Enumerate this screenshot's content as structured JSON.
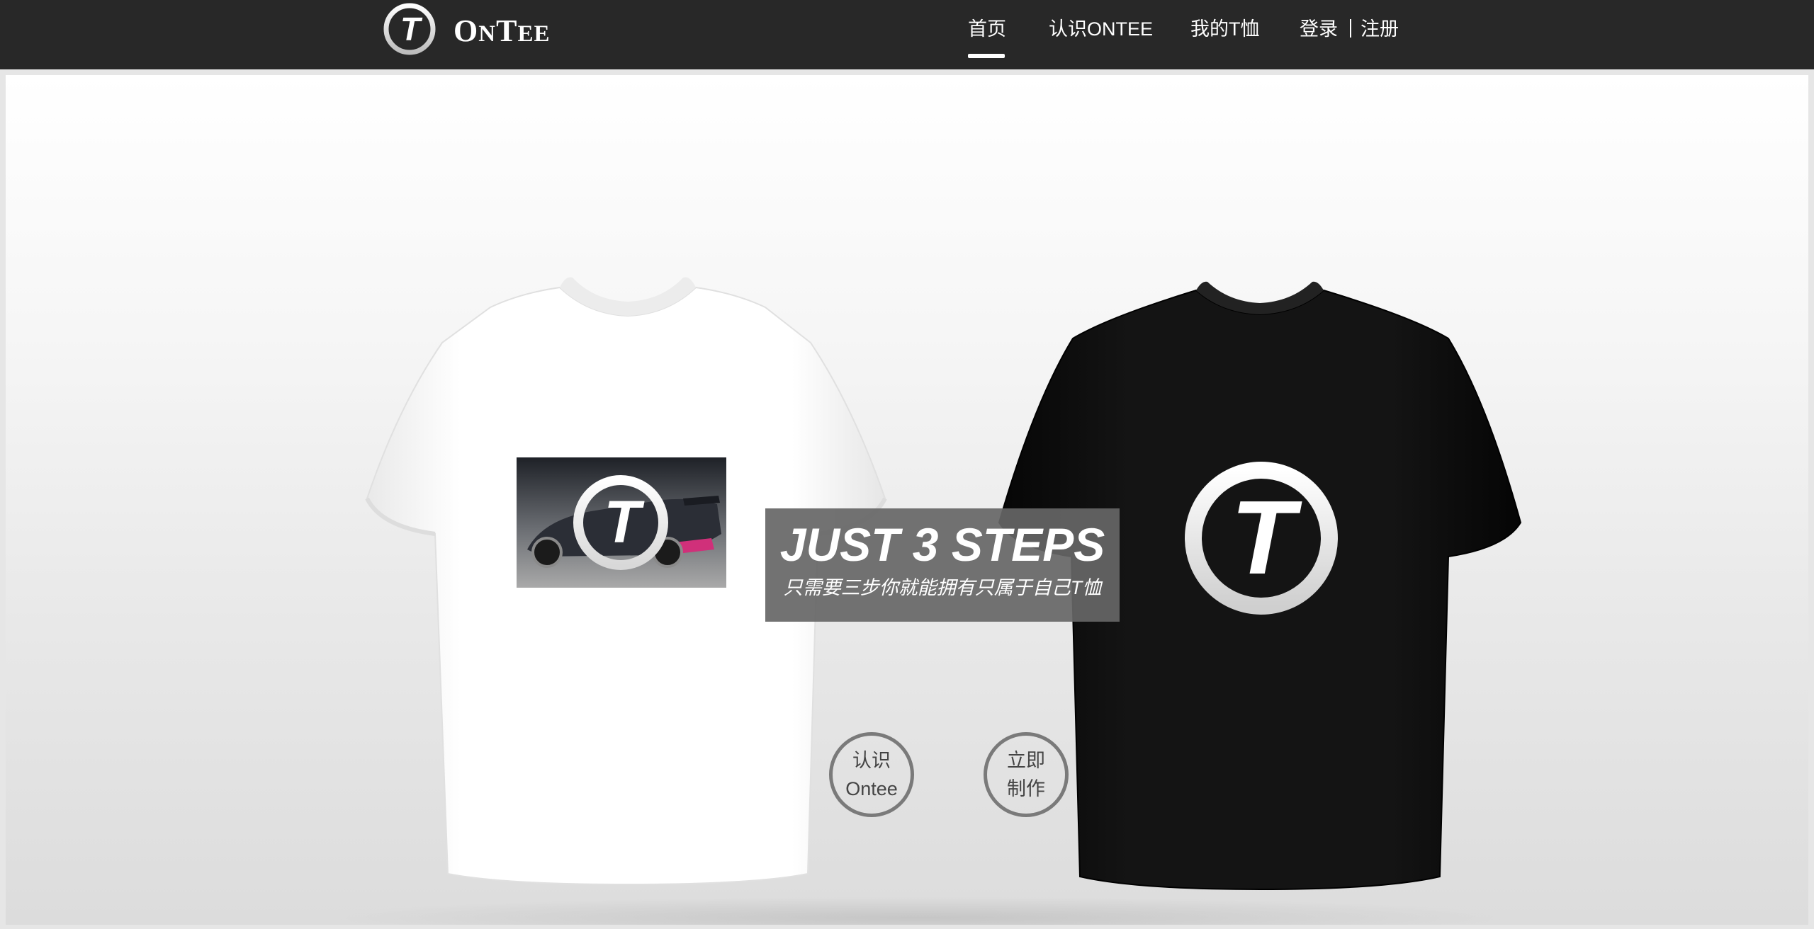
{
  "brand": {
    "name_first": "O",
    "name_mid": "N",
    "name_t": "T",
    "name_rest": "EE",
    "logo_letter": "T"
  },
  "nav": {
    "items": [
      {
        "label": "首页",
        "active": true
      },
      {
        "label": "认识ONTEE",
        "active": false
      },
      {
        "label": "我的T恤",
        "active": false
      }
    ],
    "login_label": "登录",
    "register_label": "注册"
  },
  "hero": {
    "headline": "JUST 3 STEPS",
    "subheadline": "只需要三步你就能拥有只属于自己T恤",
    "about_button": {
      "line1": "认识",
      "line2": "Ontee"
    },
    "make_button": {
      "line1": "立即",
      "line2": "制作"
    },
    "shirt_logo_letter": "T",
    "print_logo_letter": "T"
  },
  "colors": {
    "header_bg": "#282828",
    "headline_box_bg": "#666666",
    "button_border": "#7a7a7a",
    "car_accent": "#d0307a"
  }
}
